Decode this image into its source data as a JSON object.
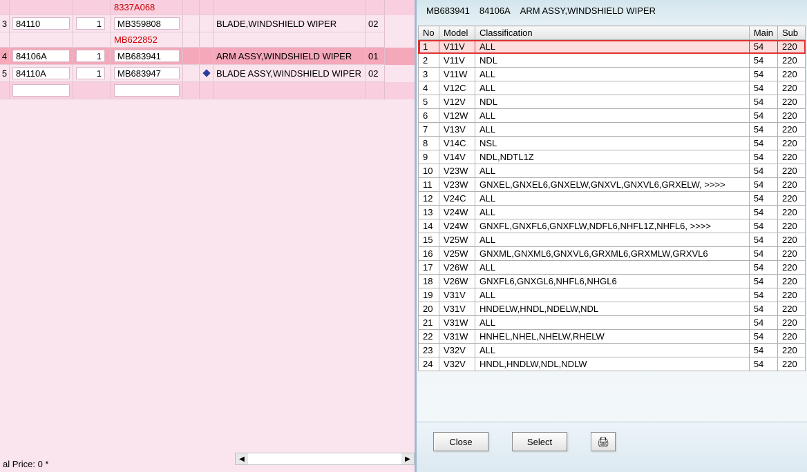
{
  "left": {
    "rows": [
      {
        "idx": "",
        "code": "",
        "qty": "",
        "partno": "8337A068",
        "icon": "",
        "desc": "",
        "tail": "",
        "variant": "striped0",
        "red": true,
        "inputs": false
      },
      {
        "idx": "3",
        "code": "84110",
        "qty": "1",
        "partno": "MB359808",
        "icon": "",
        "desc": "BLADE,WINDSHIELD WIPER",
        "tail": "02",
        "variant": "striped1",
        "red": false,
        "inputs": true
      },
      {
        "idx": "",
        "code": "",
        "qty": "",
        "partno": "MB622852",
        "icon": "",
        "desc": "",
        "tail": "",
        "variant": "striped1",
        "red": true,
        "inputs": false
      },
      {
        "idx": "4",
        "code": "84106A",
        "qty": "1",
        "partno": "MB683941",
        "icon": "",
        "desc": "ARM ASSY,WINDSHIELD WIPER",
        "tail": "01",
        "variant": "selected",
        "red": false,
        "inputs": true
      },
      {
        "idx": "5",
        "code": "84110A",
        "qty": "1",
        "partno": "MB683947",
        "icon": "diamond",
        "desc": "BLADE ASSY,WINDSHIELD WIPER",
        "tail": "02",
        "variant": "striped1",
        "red": false,
        "inputs": true
      },
      {
        "idx": "",
        "code": " ",
        "qty": "",
        "partno": " ",
        "icon": "",
        "desc": "",
        "tail": "",
        "variant": "striped0",
        "red": false,
        "inputs": true
      }
    ],
    "price_footer": "al Price: 0 *"
  },
  "right": {
    "header": {
      "partno": "MB683941",
      "code": "84106A",
      "desc": "ARM ASSY,WINDSHIELD WIPER"
    },
    "columns": {
      "no": "No",
      "model": "Model",
      "classification": "Classification",
      "main": "Main",
      "sub": "Sub"
    },
    "rows": [
      {
        "no": "1",
        "model": "V11V",
        "cls": "ALL",
        "main": "54",
        "sub": "220",
        "selected": true
      },
      {
        "no": "2",
        "model": "V11V",
        "cls": "NDL",
        "main": "54",
        "sub": "220"
      },
      {
        "no": "3",
        "model": "V11W",
        "cls": "ALL",
        "main": "54",
        "sub": "220"
      },
      {
        "no": "4",
        "model": "V12C",
        "cls": "ALL",
        "main": "54",
        "sub": "220"
      },
      {
        "no": "5",
        "model": "V12V",
        "cls": "NDL",
        "main": "54",
        "sub": "220"
      },
      {
        "no": "6",
        "model": "V12W",
        "cls": "ALL",
        "main": "54",
        "sub": "220"
      },
      {
        "no": "7",
        "model": "V13V",
        "cls": "ALL",
        "main": "54",
        "sub": "220"
      },
      {
        "no": "8",
        "model": "V14C",
        "cls": "NSL",
        "main": "54",
        "sub": "220"
      },
      {
        "no": "9",
        "model": "V14V",
        "cls": "NDL,NDTL1Z",
        "main": "54",
        "sub": "220"
      },
      {
        "no": "10",
        "model": "V23W",
        "cls": "ALL",
        "main": "54",
        "sub": "220"
      },
      {
        "no": "11",
        "model": "V23W",
        "cls": "GNXEL,GNXEL6,GNXELW,GNXVL,GNXVL6,GRXELW,  >>>>",
        "main": "54",
        "sub": "220"
      },
      {
        "no": "12",
        "model": "V24C",
        "cls": "ALL",
        "main": "54",
        "sub": "220"
      },
      {
        "no": "13",
        "model": "V24W",
        "cls": "ALL",
        "main": "54",
        "sub": "220"
      },
      {
        "no": "14",
        "model": "V24W",
        "cls": "GNXFL,GNXFL6,GNXFLW,NDFL6,NHFL1Z,NHFL6,  >>>>",
        "main": "54",
        "sub": "220"
      },
      {
        "no": "15",
        "model": "V25W",
        "cls": "ALL",
        "main": "54",
        "sub": "220"
      },
      {
        "no": "16",
        "model": "V25W",
        "cls": "GNXML,GNXML6,GNXVL6,GRXML6,GRXMLW,GRXVL6",
        "main": "54",
        "sub": "220"
      },
      {
        "no": "17",
        "model": "V26W",
        "cls": "ALL",
        "main": "54",
        "sub": "220"
      },
      {
        "no": "18",
        "model": "V26W",
        "cls": "GNXFL6,GNXGL6,NHFL6,NHGL6",
        "main": "54",
        "sub": "220"
      },
      {
        "no": "19",
        "model": "V31V",
        "cls": "ALL",
        "main": "54",
        "sub": "220"
      },
      {
        "no": "20",
        "model": "V31V",
        "cls": "HNDELW,HNDL,NDELW,NDL",
        "main": "54",
        "sub": "220"
      },
      {
        "no": "21",
        "model": "V31W",
        "cls": "ALL",
        "main": "54",
        "sub": "220"
      },
      {
        "no": "22",
        "model": "V31W",
        "cls": "HNHEL,NHEL,NHELW,RHELW",
        "main": "54",
        "sub": "220"
      },
      {
        "no": "23",
        "model": "V32V",
        "cls": "ALL",
        "main": "54",
        "sub": "220"
      },
      {
        "no": "24",
        "model": "V32V",
        "cls": "HNDL,HNDLW,NDL,NDLW",
        "main": "54",
        "sub": "220"
      }
    ],
    "buttons": {
      "close": "Close",
      "select": "Select"
    }
  }
}
